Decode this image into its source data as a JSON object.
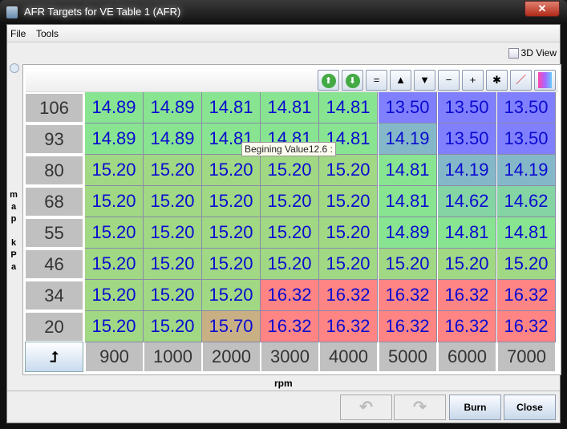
{
  "window": {
    "title": "AFR Targets for VE Table 1 (AFR)"
  },
  "menu": {
    "file": "File",
    "tools": "Tools"
  },
  "view3d": {
    "label": "3D View",
    "checked": false
  },
  "toolbar": [
    "=",
    "▲",
    "▼",
    "−",
    "+",
    "*"
  ],
  "toolbar_icons": [
    "increase-green-icon",
    "decrease-green-icon",
    "set-equal-icon",
    "shift-up-icon",
    "shift-down-icon",
    "minus-icon",
    "plus-icon",
    "multiply-icon",
    "pen-icon",
    "color-gradient-icon"
  ],
  "y_axis": {
    "label": "map kPa",
    "values": [
      "106",
      "93",
      "80",
      "68",
      "55",
      "46",
      "34",
      "20"
    ]
  },
  "x_axis": {
    "label": "rpm",
    "values": [
      "900",
      "1000",
      "2000",
      "3000",
      "4000",
      "5000",
      "6000",
      "7000"
    ]
  },
  "table": [
    [
      "14.89",
      "14.89",
      "14.81",
      "14.81",
      "14.81",
      "13.50",
      "13.50",
      "13.50"
    ],
    [
      "14.89",
      "14.89",
      "14.81",
      "14.81",
      "14.81",
      "14.19",
      "13.50",
      "13.50"
    ],
    [
      "15.20",
      "15.20",
      "15.20",
      "15.20",
      "15.20",
      "14.81",
      "14.19",
      "14.19"
    ],
    [
      "15.20",
      "15.20",
      "15.20",
      "15.20",
      "15.20",
      "14.81",
      "14.62",
      "14.62"
    ],
    [
      "15.20",
      "15.20",
      "15.20",
      "15.20",
      "15.20",
      "14.89",
      "14.81",
      "14.81"
    ],
    [
      "15.20",
      "15.20",
      "15.20",
      "15.20",
      "15.20",
      "15.20",
      "15.20",
      "15.20"
    ],
    [
      "15.20",
      "15.20",
      "15.20",
      "16.32",
      "16.32",
      "16.32",
      "16.32",
      "16.32"
    ],
    [
      "15.20",
      "15.20",
      "15.70",
      "16.32",
      "16.32",
      "16.32",
      "16.32",
      "16.32"
    ]
  ],
  "colors": {
    "13.50": "#8080ff",
    "14.19": "#84b8c8",
    "14.62": "#84d4a4",
    "14.81": "#88e490",
    "14.89": "#88e490",
    "15.20": "#a0d884",
    "15.70": "#c8b084",
    "16.32": "#ff8484"
  },
  "tooltip": "Begining Value12.6 :",
  "buttons": {
    "burn": "Burn",
    "close": "Close"
  }
}
